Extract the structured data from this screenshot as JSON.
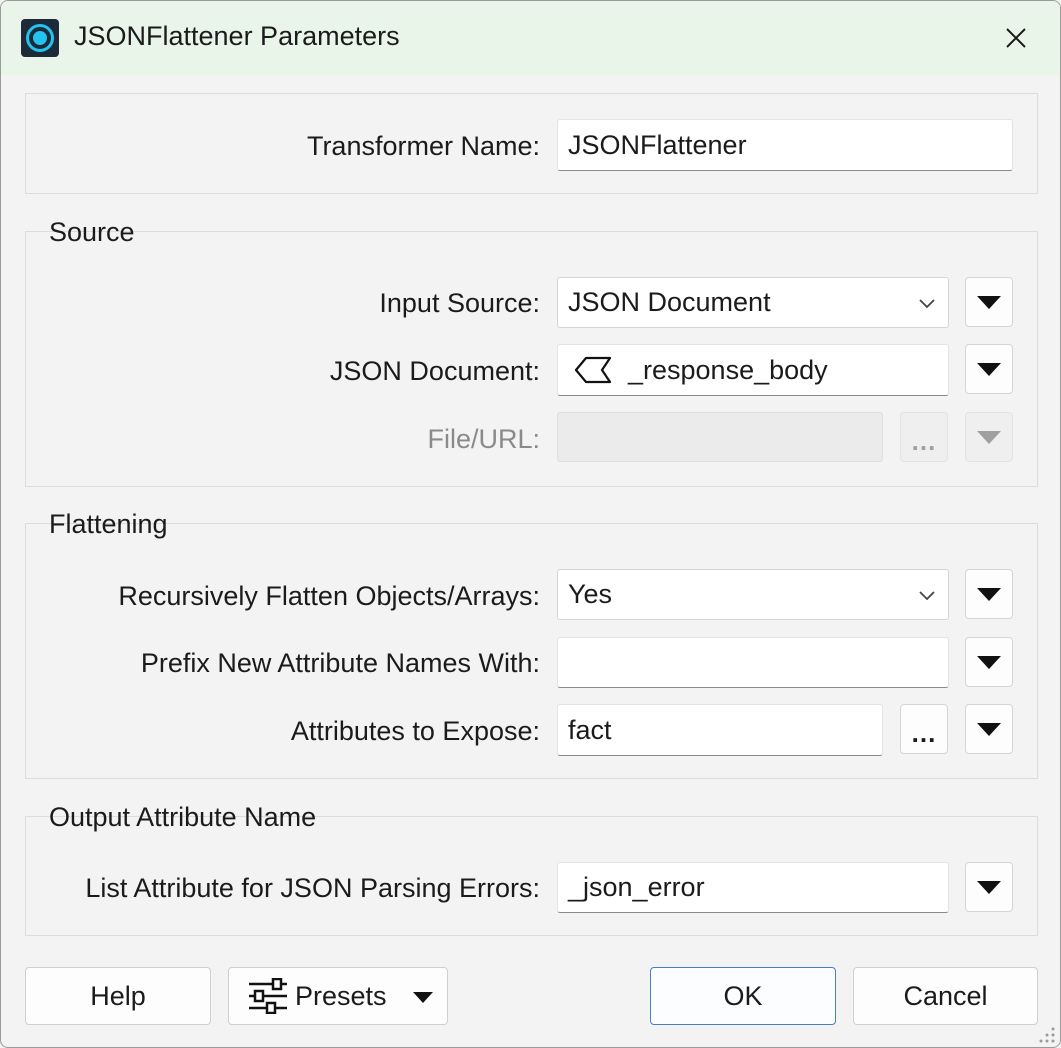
{
  "window": {
    "title": "JSONFlattener Parameters",
    "app_icon": "fme-workbench-icon",
    "close_icon": "close-icon"
  },
  "transformer": {
    "label": "Transformer Name:",
    "value": "JSONFlattener"
  },
  "source": {
    "title": "Source",
    "input_source": {
      "label": "Input Source:",
      "value": "JSON Document"
    },
    "json_document": {
      "label": "JSON Document:",
      "value": "_response_body",
      "icon": "attribute-icon"
    },
    "file_url": {
      "label": "File/URL:",
      "value": "",
      "browse": "..."
    }
  },
  "flattening": {
    "title": "Flattening",
    "recursive": {
      "label": "Recursively Flatten Objects/Arrays:",
      "value": "Yes"
    },
    "prefix": {
      "label": "Prefix New Attribute Names With:",
      "value": ""
    },
    "expose": {
      "label": "Attributes to Expose:",
      "value": "fact",
      "browse": "..."
    }
  },
  "output": {
    "title": "Output Attribute Name",
    "errors": {
      "label": "List Attribute for JSON Parsing Errors:",
      "value": "_json_error"
    }
  },
  "buttons": {
    "help": "Help",
    "presets": "Presets",
    "ok": "OK",
    "cancel": "Cancel"
  }
}
